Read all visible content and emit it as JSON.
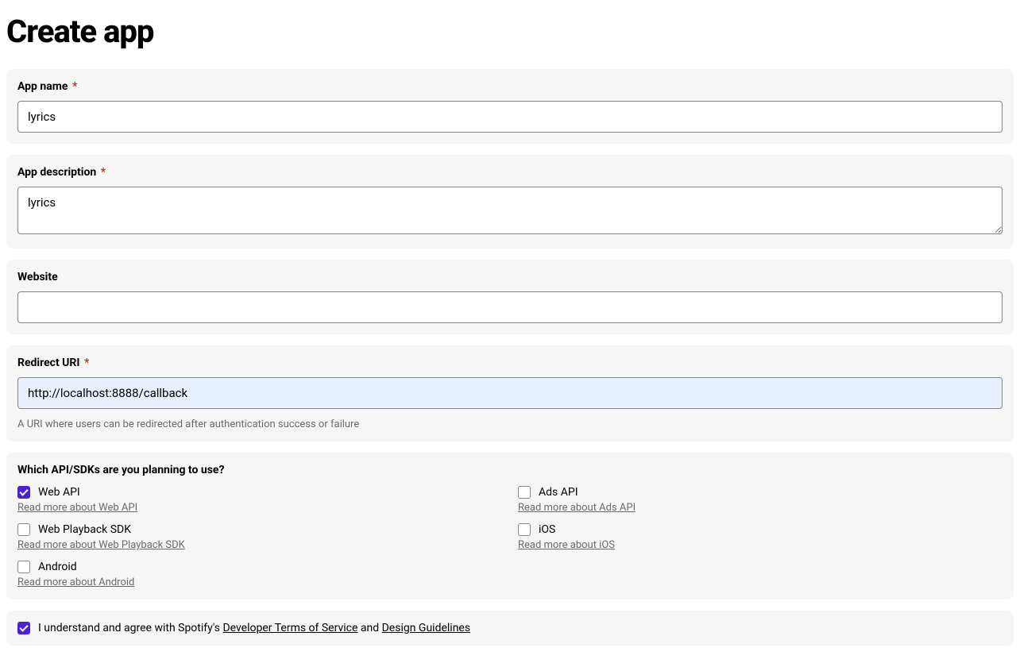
{
  "page_title": "Create app",
  "fields": {
    "app_name": {
      "label": "App name",
      "required": "*",
      "value": "lyrics"
    },
    "app_description": {
      "label": "App description",
      "required": "*",
      "value": "lyrics"
    },
    "website": {
      "label": "Website",
      "value": ""
    },
    "redirect_uri": {
      "label": "Redirect URI",
      "required": "*",
      "value": "http://localhost:8888/callback",
      "helper": "A URI where users can be redirected after authentication success or failure"
    }
  },
  "apis": {
    "question": "Which API/SDKs are you planning to use?",
    "items": [
      {
        "label": "Web API",
        "readmore": "Read more about Web API",
        "checked": true
      },
      {
        "label": "Ads API",
        "readmore": "Read more about Ads API",
        "checked": false
      },
      {
        "label": "Web Playback SDK",
        "readmore": "Read more about Web Playback SDK",
        "checked": false
      },
      {
        "label": "iOS",
        "readmore": "Read more about iOS",
        "checked": false
      },
      {
        "label": "Android",
        "readmore": "Read more about Android",
        "checked": false
      }
    ]
  },
  "agreement": {
    "checked": true,
    "prefix": "I understand and agree with Spotify's ",
    "link1": "Developer Terms of Service",
    "connector": " and ",
    "link2": "Design Guidelines"
  }
}
